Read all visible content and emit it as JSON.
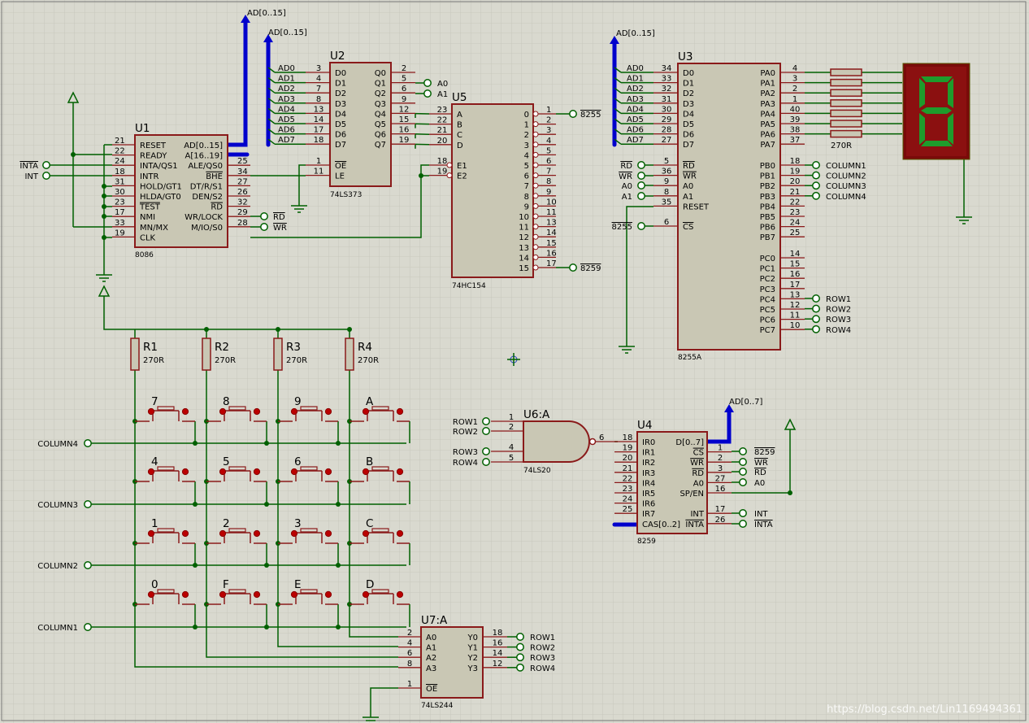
{
  "components": {
    "u1": {
      "ref": "U1",
      "type": "8086",
      "left_pins": [
        {
          "num": "21",
          "name": "RESET"
        },
        {
          "num": "22",
          "name": "READY"
        },
        {
          "num": "24",
          "name": "INTA/QS1"
        },
        {
          "num": "18",
          "name": "INTR"
        },
        {
          "num": "31",
          "name": "HOLD/GT1"
        },
        {
          "num": "30",
          "name": "HLDA/GT0"
        },
        {
          "num": "23",
          "name": "TEST"
        },
        {
          "num": "17",
          "name": "NMI"
        },
        {
          "num": "33",
          "name": "MN/MX"
        },
        {
          "num": "19",
          "name": "CLK"
        }
      ],
      "right_pins": [
        {
          "num": "",
          "name": "AD[0..15]"
        },
        {
          "num": "",
          "name": "A[16..19]"
        },
        {
          "num": "25",
          "name": "ALE/QS0"
        },
        {
          "num": "34",
          "name": "BHE"
        },
        {
          "num": "27",
          "name": "DT/R/S1"
        },
        {
          "num": "26",
          "name": "DEN/S2"
        },
        {
          "num": "32",
          "name": "RD"
        },
        {
          "num": "29",
          "name": "WR/LOCK"
        },
        {
          "num": "28",
          "name": "M/IO/S0"
        }
      ]
    },
    "u2": {
      "ref": "U2",
      "type": "74LS373",
      "left_pins": [
        {
          "num": "3",
          "name": "D0"
        },
        {
          "num": "4",
          "name": "D1"
        },
        {
          "num": "7",
          "name": "D2"
        },
        {
          "num": "8",
          "name": "D3"
        },
        {
          "num": "13",
          "name": "D4"
        },
        {
          "num": "14",
          "name": "D5"
        },
        {
          "num": "17",
          "name": "D6"
        },
        {
          "num": "18",
          "name": "D7"
        },
        {
          "num": "1",
          "name": "OE"
        },
        {
          "num": "11",
          "name": "LE"
        }
      ],
      "right_pins": [
        {
          "num": "2",
          "name": "Q0"
        },
        {
          "num": "5",
          "name": "Q1"
        },
        {
          "num": "6",
          "name": "Q2"
        },
        {
          "num": "9",
          "name": "Q3"
        },
        {
          "num": "12",
          "name": "Q4"
        },
        {
          "num": "15",
          "name": "Q5"
        },
        {
          "num": "16",
          "name": "Q6"
        },
        {
          "num": "19",
          "name": "Q7"
        }
      ]
    },
    "u5": {
      "ref": "U5",
      "type": "74HC154",
      "left_pins": [
        {
          "num": "23",
          "name": "A"
        },
        {
          "num": "22",
          "name": "B"
        },
        {
          "num": "21",
          "name": "C"
        },
        {
          "num": "20",
          "name": "D"
        },
        {
          "num": "18",
          "name": "E1"
        },
        {
          "num": "19",
          "name": "E2"
        }
      ],
      "out_names": [
        "0",
        "1",
        "2",
        "3",
        "4",
        "5",
        "6",
        "7",
        "8",
        "9",
        "10",
        "11",
        "12",
        "13",
        "14",
        "15"
      ],
      "out_nums": [
        "1",
        "2",
        "3",
        "4",
        "5",
        "6",
        "7",
        "8",
        "9",
        "10",
        "11",
        "13",
        "14",
        "15",
        "16",
        "17"
      ]
    },
    "u3": {
      "ref": "U3",
      "type": "8255A",
      "left_pins": [
        {
          "num": "34",
          "name": "D0"
        },
        {
          "num": "33",
          "name": "D1"
        },
        {
          "num": "32",
          "name": "D2"
        },
        {
          "num": "31",
          "name": "D3"
        },
        {
          "num": "30",
          "name": "D4"
        },
        {
          "num": "29",
          "name": "D5"
        },
        {
          "num": "28",
          "name": "D6"
        },
        {
          "num": "27",
          "name": "D7"
        },
        {
          "num": "5",
          "name": "RD"
        },
        {
          "num": "36",
          "name": "WR"
        },
        {
          "num": "9",
          "name": "A0"
        },
        {
          "num": "8",
          "name": "A1"
        },
        {
          "num": "35",
          "name": "RESET"
        },
        {
          "num": "6",
          "name": "CS"
        }
      ],
      "right_pins": [
        {
          "num": "4",
          "name": "PA0"
        },
        {
          "num": "3",
          "name": "PA1"
        },
        {
          "num": "2",
          "name": "PA2"
        },
        {
          "num": "1",
          "name": "PA3"
        },
        {
          "num": "40",
          "name": "PA4"
        },
        {
          "num": "39",
          "name": "PA5"
        },
        {
          "num": "38",
          "name": "PA6"
        },
        {
          "num": "37",
          "name": "PA7"
        },
        {
          "num": "18",
          "name": "PB0"
        },
        {
          "num": "19",
          "name": "PB1"
        },
        {
          "num": "20",
          "name": "PB2"
        },
        {
          "num": "21",
          "name": "PB3"
        },
        {
          "num": "22",
          "name": "PB4"
        },
        {
          "num": "23",
          "name": "PB5"
        },
        {
          "num": "24",
          "name": "PB6"
        },
        {
          "num": "25",
          "name": "PB7"
        },
        {
          "num": "14",
          "name": "PC0"
        },
        {
          "num": "15",
          "name": "PC1"
        },
        {
          "num": "16",
          "name": "PC2"
        },
        {
          "num": "17",
          "name": "PC3"
        },
        {
          "num": "13",
          "name": "PC4"
        },
        {
          "num": "12",
          "name": "PC5"
        },
        {
          "num": "11",
          "name": "PC6"
        },
        {
          "num": "10",
          "name": "PC7"
        }
      ]
    },
    "u4": {
      "ref": "U4",
      "type": "8259",
      "left_pins": [
        {
          "num": "18",
          "name": "IR0"
        },
        {
          "num": "19",
          "name": "IR1"
        },
        {
          "num": "20",
          "name": "IR2"
        },
        {
          "num": "21",
          "name": "IR3"
        },
        {
          "num": "22",
          "name": "IR4"
        },
        {
          "num": "23",
          "name": "IR5"
        },
        {
          "num": "24",
          "name": "IR6"
        },
        {
          "num": "25",
          "name": "IR7"
        },
        {
          "num": "",
          "name": "CAS[0..2]"
        }
      ],
      "right_pins": [
        {
          "num": "",
          "name": "D[0..7]"
        },
        {
          "num": "1",
          "name": "CS"
        },
        {
          "num": "2",
          "name": "WR"
        },
        {
          "num": "3",
          "name": "RD"
        },
        {
          "num": "27",
          "name": "A0"
        },
        {
          "num": "16",
          "name": "SP/EN"
        },
        {
          "num": "",
          "name": ""
        },
        {
          "num": "17",
          "name": "INT"
        },
        {
          "num": "26",
          "name": "INTA"
        }
      ]
    },
    "u6": {
      "ref": "U6:A",
      "type": "74LS20",
      "in_nums": [
        "1",
        "2",
        "4",
        "5"
      ],
      "out_num": "6"
    },
    "u7": {
      "ref": "U7:A",
      "type": "74LS244",
      "left_pins": [
        {
          "num": "2",
          "name": "A0"
        },
        {
          "num": "4",
          "name": "A1"
        },
        {
          "num": "6",
          "name": "A2"
        },
        {
          "num": "8",
          "name": "A3"
        },
        {
          "num": "1",
          "name": "OE"
        }
      ],
      "right_pins": [
        {
          "num": "18",
          "name": "Y0"
        },
        {
          "num": "16",
          "name": "Y1"
        },
        {
          "num": "14",
          "name": "Y2"
        },
        {
          "num": "12",
          "name": "Y3"
        }
      ]
    },
    "resistors": [
      {
        "ref": "R1",
        "value": "270R"
      },
      {
        "ref": "R2",
        "value": "270R"
      },
      {
        "ref": "R3",
        "value": "270R"
      },
      {
        "ref": "R4",
        "value": "270R"
      }
    ],
    "seg_resistor_value": "270R"
  },
  "labels": {
    "bus_ad15": "AD[0..15]",
    "bus_ad7": "AD[0..7]",
    "ad_lines": [
      "AD0",
      "AD1",
      "AD2",
      "AD3",
      "AD4",
      "AD5",
      "AD6",
      "AD7"
    ],
    "ports": {
      "inta": "INTA",
      "int": "INT",
      "rd": "RD",
      "wr": "WR",
      "a0": "A0",
      "a1": "A1",
      "sel_8255": "8255",
      "sel_8259": "8259",
      "columns": [
        "COLUMN1",
        "COLUMN2",
        "COLUMN3",
        "COLUMN4"
      ],
      "rows": [
        "ROW1",
        "ROW2",
        "ROW3",
        "ROW4"
      ],
      "kbd_columns": [
        "COLUMN4",
        "COLUMN3",
        "COLUMN2",
        "COLUMN1"
      ]
    },
    "keys": [
      [
        "7",
        "8",
        "9",
        "A"
      ],
      [
        "4",
        "5",
        "6",
        "B"
      ],
      [
        "1",
        "2",
        "3",
        "C"
      ],
      [
        "0",
        "F",
        "E",
        "D"
      ]
    ]
  },
  "colors": {
    "background": "#d9d9cf",
    "grid": "#c4c4b9",
    "chip_fill": "#c9c7b4",
    "chip_border": "#8a1a1a",
    "wire": "#006000",
    "bus": "#0000cc",
    "seg_on": "#1e9c2c",
    "seg_bg": "#7a0a0a"
  },
  "watermark": "https://blog.csdn.net/Lin1169494361"
}
